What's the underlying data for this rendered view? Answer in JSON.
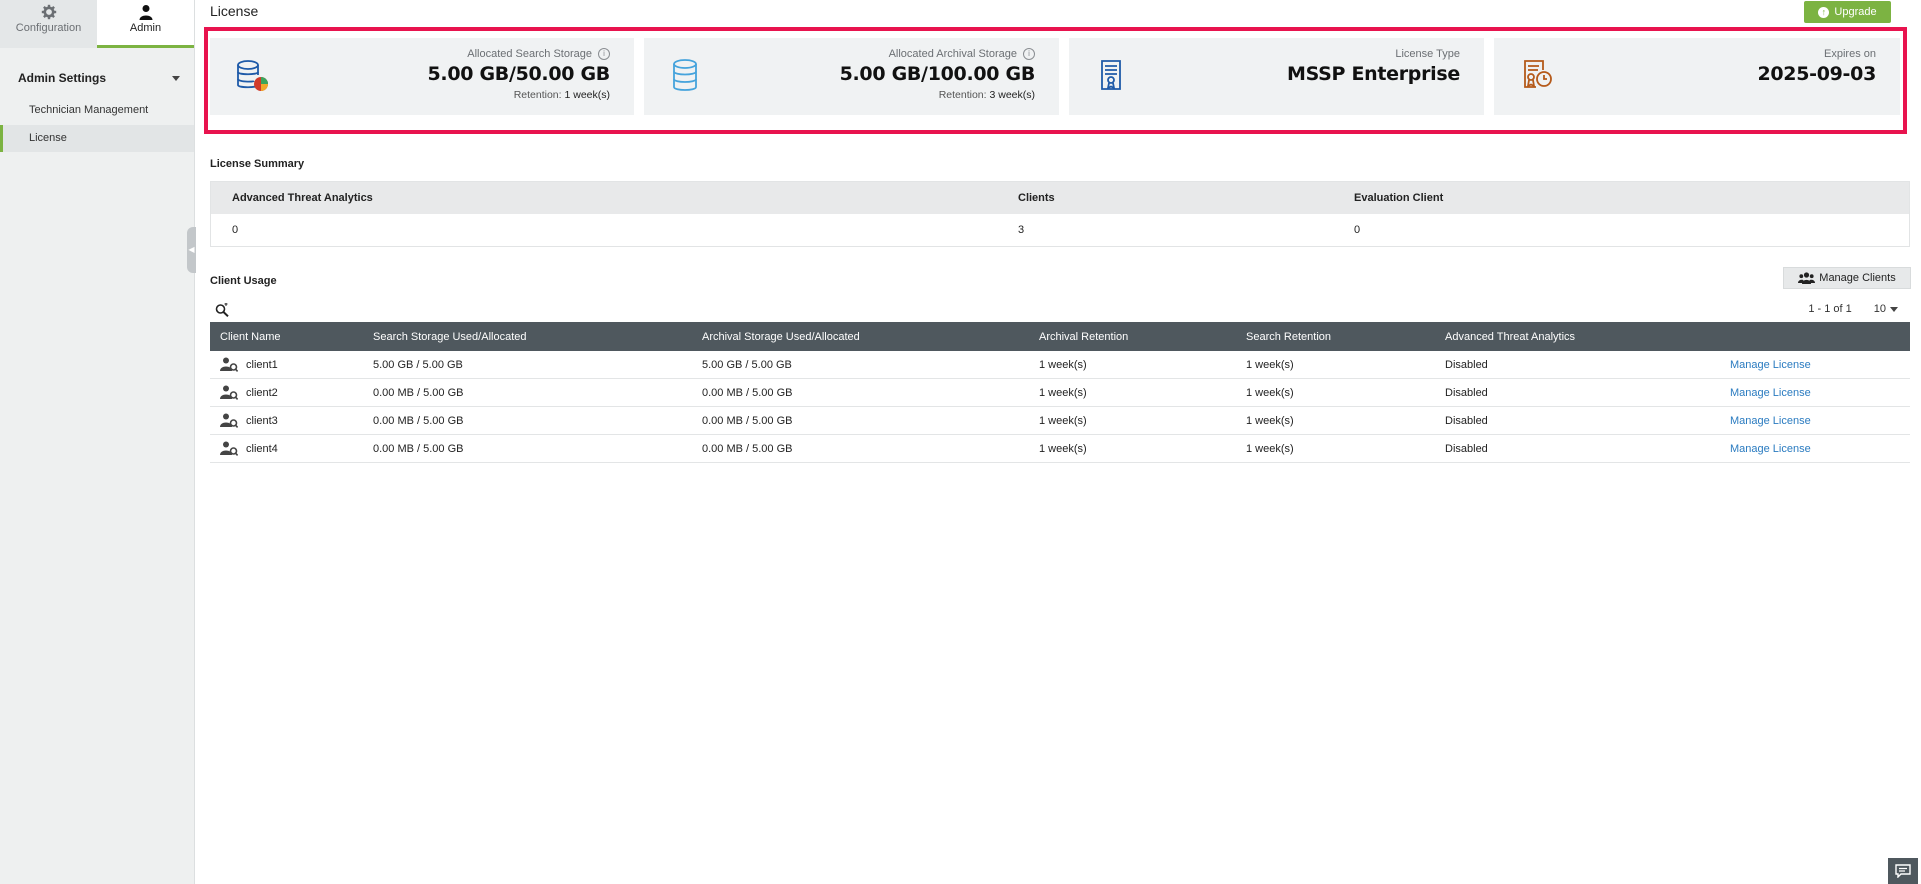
{
  "nav": {
    "tabs": [
      {
        "label": "Configuration",
        "icon": "gear-icon"
      },
      {
        "label": "Admin",
        "icon": "user-icon"
      }
    ],
    "admin_settings": "Admin Settings",
    "items": [
      {
        "label": "Technician Management"
      },
      {
        "label": "License"
      }
    ]
  },
  "header": {
    "title": "License",
    "upgrade": "Upgrade"
  },
  "cards": [
    {
      "label": "Allocated Search Storage",
      "value": "5.00 GB/50.00 GB",
      "retention_label": "Retention:",
      "retention_value": "1 week(s)"
    },
    {
      "label": "Allocated Archival Storage",
      "value": "5.00 GB/100.00 GB",
      "retention_label": "Retention:",
      "retention_value": "3 week(s)"
    },
    {
      "label": "License Type",
      "value": "MSSP Enterprise"
    },
    {
      "label": "Expires on",
      "value": "2025-09-03"
    }
  ],
  "summary": {
    "title": "License Summary",
    "headers": [
      "Advanced Threat Analytics",
      "Clients",
      "Evaluation Client"
    ],
    "values": [
      "0",
      "3",
      "0"
    ]
  },
  "usage": {
    "title": "Client Usage",
    "manage_clients": "Manage Clients",
    "pagination": "1 - 1 of 1",
    "page_size": "10",
    "headers": [
      "Client Name",
      "Search Storage Used/Allocated",
      "Archival Storage Used/Allocated",
      "Archival Retention",
      "Search Retention",
      "Advanced Threat Analytics",
      ""
    ],
    "rows": [
      {
        "name": "client1",
        "search": "5.00 GB / 5.00 GB",
        "archival": "5.00 GB / 5.00 GB",
        "archival_retention": "1 week(s)",
        "search_retention": "1 week(s)",
        "ata": "Disabled",
        "action": "Manage License"
      },
      {
        "name": "client2",
        "search": "0.00 MB / 5.00 GB",
        "archival": "0.00 MB / 5.00 GB",
        "archival_retention": "1 week(s)",
        "search_retention": "1 week(s)",
        "ata": "Disabled",
        "action": "Manage License"
      },
      {
        "name": "client3",
        "search": "0.00 MB / 5.00 GB",
        "archival": "0.00 MB / 5.00 GB",
        "archival_retention": "1 week(s)",
        "search_retention": "1 week(s)",
        "ata": "Disabled",
        "action": "Manage License"
      },
      {
        "name": "client4",
        "search": "0.00 MB / 5.00 GB",
        "archival": "0.00 MB / 5.00 GB",
        "archival_retention": "1 week(s)",
        "search_retention": "1 week(s)",
        "ata": "Disabled",
        "action": "Manage License"
      }
    ]
  },
  "colors": {
    "accent": "#7cb342",
    "highlight": "#e8134e",
    "table_header": "#4f585e",
    "link": "#2a7bc0"
  }
}
